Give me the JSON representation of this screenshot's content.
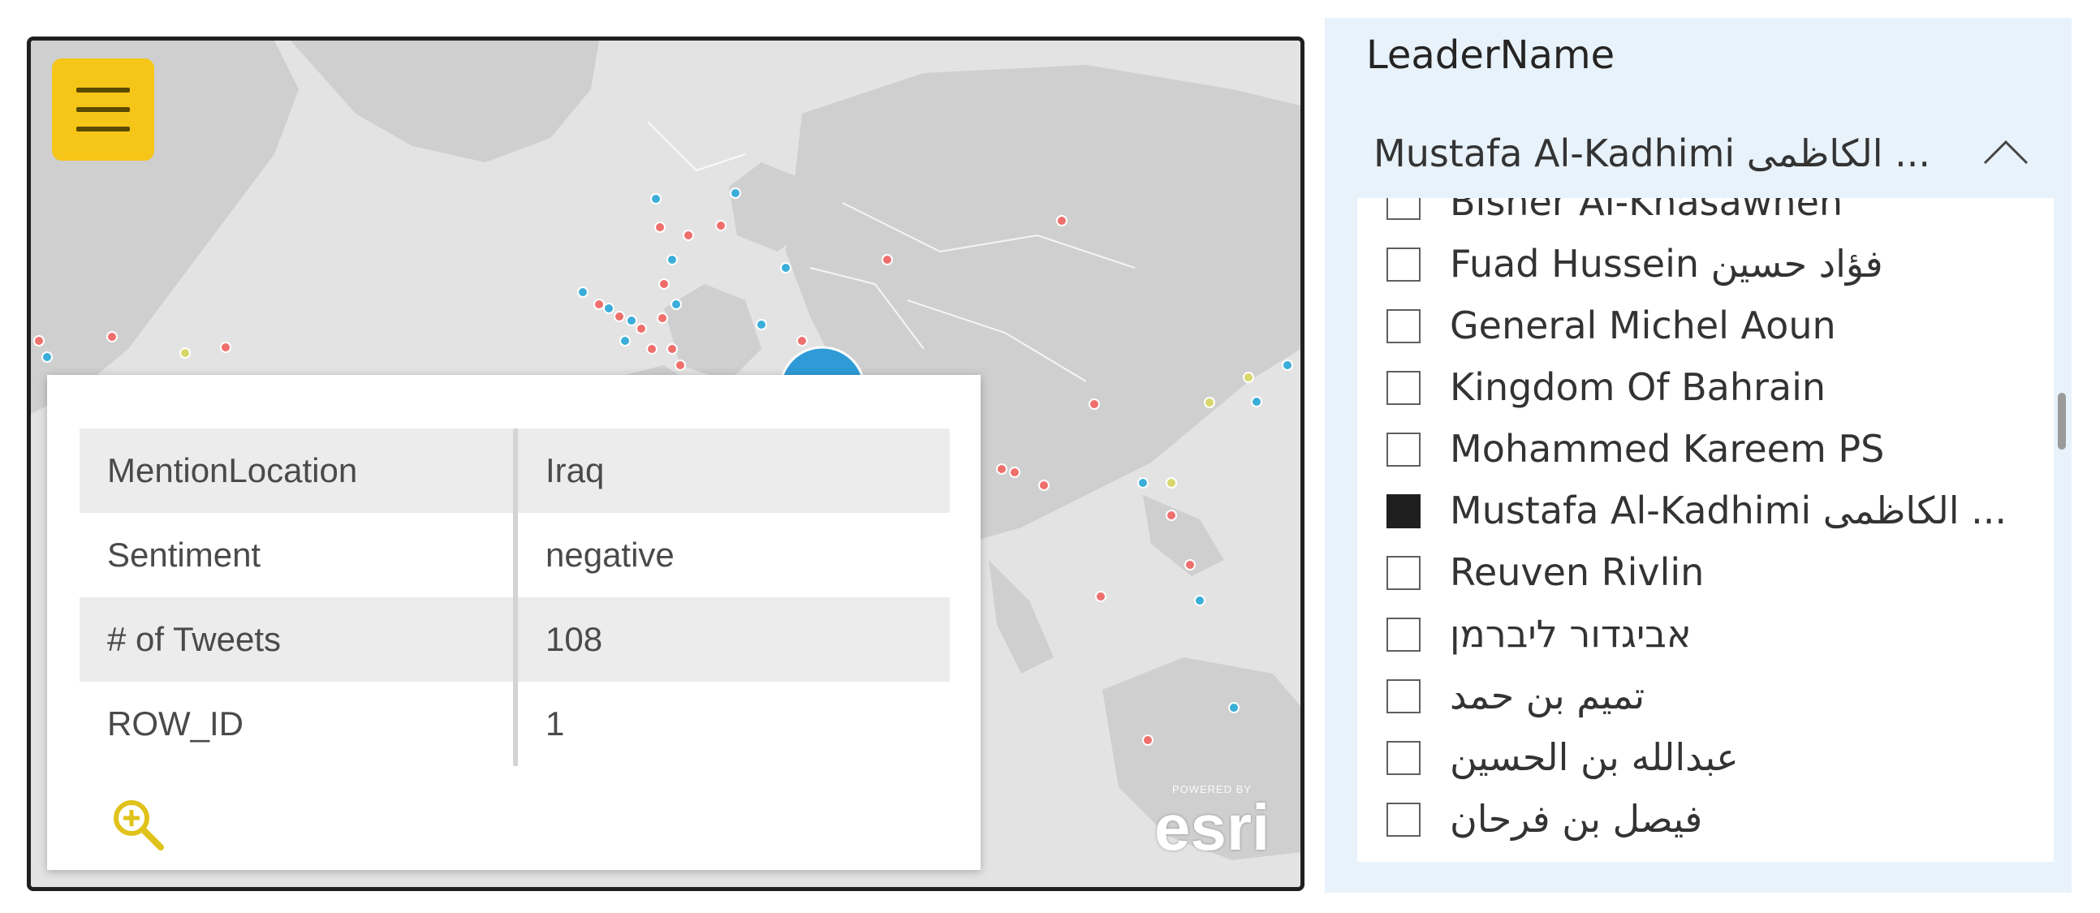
{
  "map": {
    "menu_icon": "hamburger-menu-icon",
    "popup": {
      "rows": [
        {
          "key": "MentionLocation",
          "value": "Iraq"
        },
        {
          "key": "Sentiment",
          "value": "negative"
        },
        {
          "key": "# of Tweets",
          "value": "108"
        },
        {
          "key": "ROW_ID",
          "value": "1"
        }
      ],
      "zoom_icon": "zoom-in-icon"
    },
    "logo": {
      "powered_by": "POWERED BY",
      "wordmark": "esri"
    },
    "colors": {
      "accent": "#f5c518",
      "point_red": "#ef6f6c",
      "point_blue": "#3aaed8",
      "point_yellow": "#d7d76b",
      "cluster": "#2e9bd6"
    }
  },
  "slicer": {
    "title": "LeaderName",
    "selected_value": "Mustafa Al-Kadhimi الكاظمى ...",
    "items": [
      {
        "label": "Bisher Al-Khasawneh",
        "checked": false
      },
      {
        "label": "Fuad Hussein فؤاد حسين",
        "checked": false
      },
      {
        "label": "General Michel Aoun",
        "checked": false
      },
      {
        "label": "Kingdom Of Bahrain",
        "checked": false
      },
      {
        "label": "Mohammed Kareem PS",
        "checked": false
      },
      {
        "label": "Mustafa Al-Kadhimi الكاظمى ...",
        "checked": true
      },
      {
        "label": "Reuven Rivlin",
        "checked": false
      },
      {
        "label": "אביגדור ליברמן",
        "checked": false
      },
      {
        "label": "تميم بن حمد",
        "checked": false
      },
      {
        "label": "عبدالله بن الحسين",
        "checked": false
      },
      {
        "label": "فيصل بن فرحان",
        "checked": false
      }
    ]
  }
}
